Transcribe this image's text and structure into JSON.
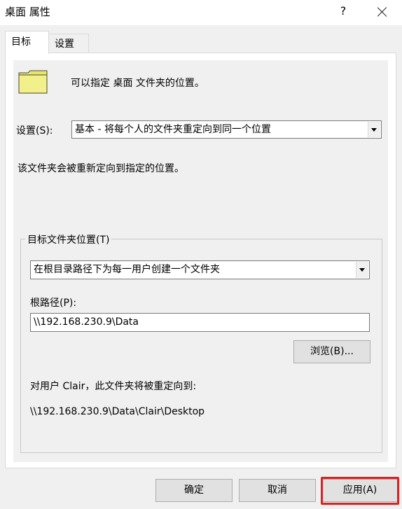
{
  "window": {
    "title": "桌面 属性",
    "help_label": "?"
  },
  "tabs": [
    {
      "label": "目标"
    },
    {
      "label": "设置"
    }
  ],
  "target": {
    "description": "可以指定 桌面 文件夹的位置。",
    "setting_label": "设置(S):",
    "setting_value": "基本 - 将每个人的文件夹重定向到同一个位置",
    "redirect_note": "该文件夹会被重新定向到指定的位置。",
    "location_group_label": "目标文件夹位置(T)",
    "location_value": "在根目录路径下为每一用户创建一个文件夹",
    "root_path_label": "根路径(P):",
    "root_path_value": "\\\\192.168.230.9\\Data",
    "browse_label": "浏览(B)...",
    "user_redirect_label": "对用户 Clair，此文件夹将被重定向到:",
    "user_redirect_path": "\\\\192.168.230.9\\Data\\Clair\\Desktop"
  },
  "footer": {
    "ok_label": "确定",
    "cancel_label": "取消",
    "apply_label": "应用(A)"
  },
  "colors": {
    "highlight": "#e02020",
    "folder": "#f2f08a"
  }
}
